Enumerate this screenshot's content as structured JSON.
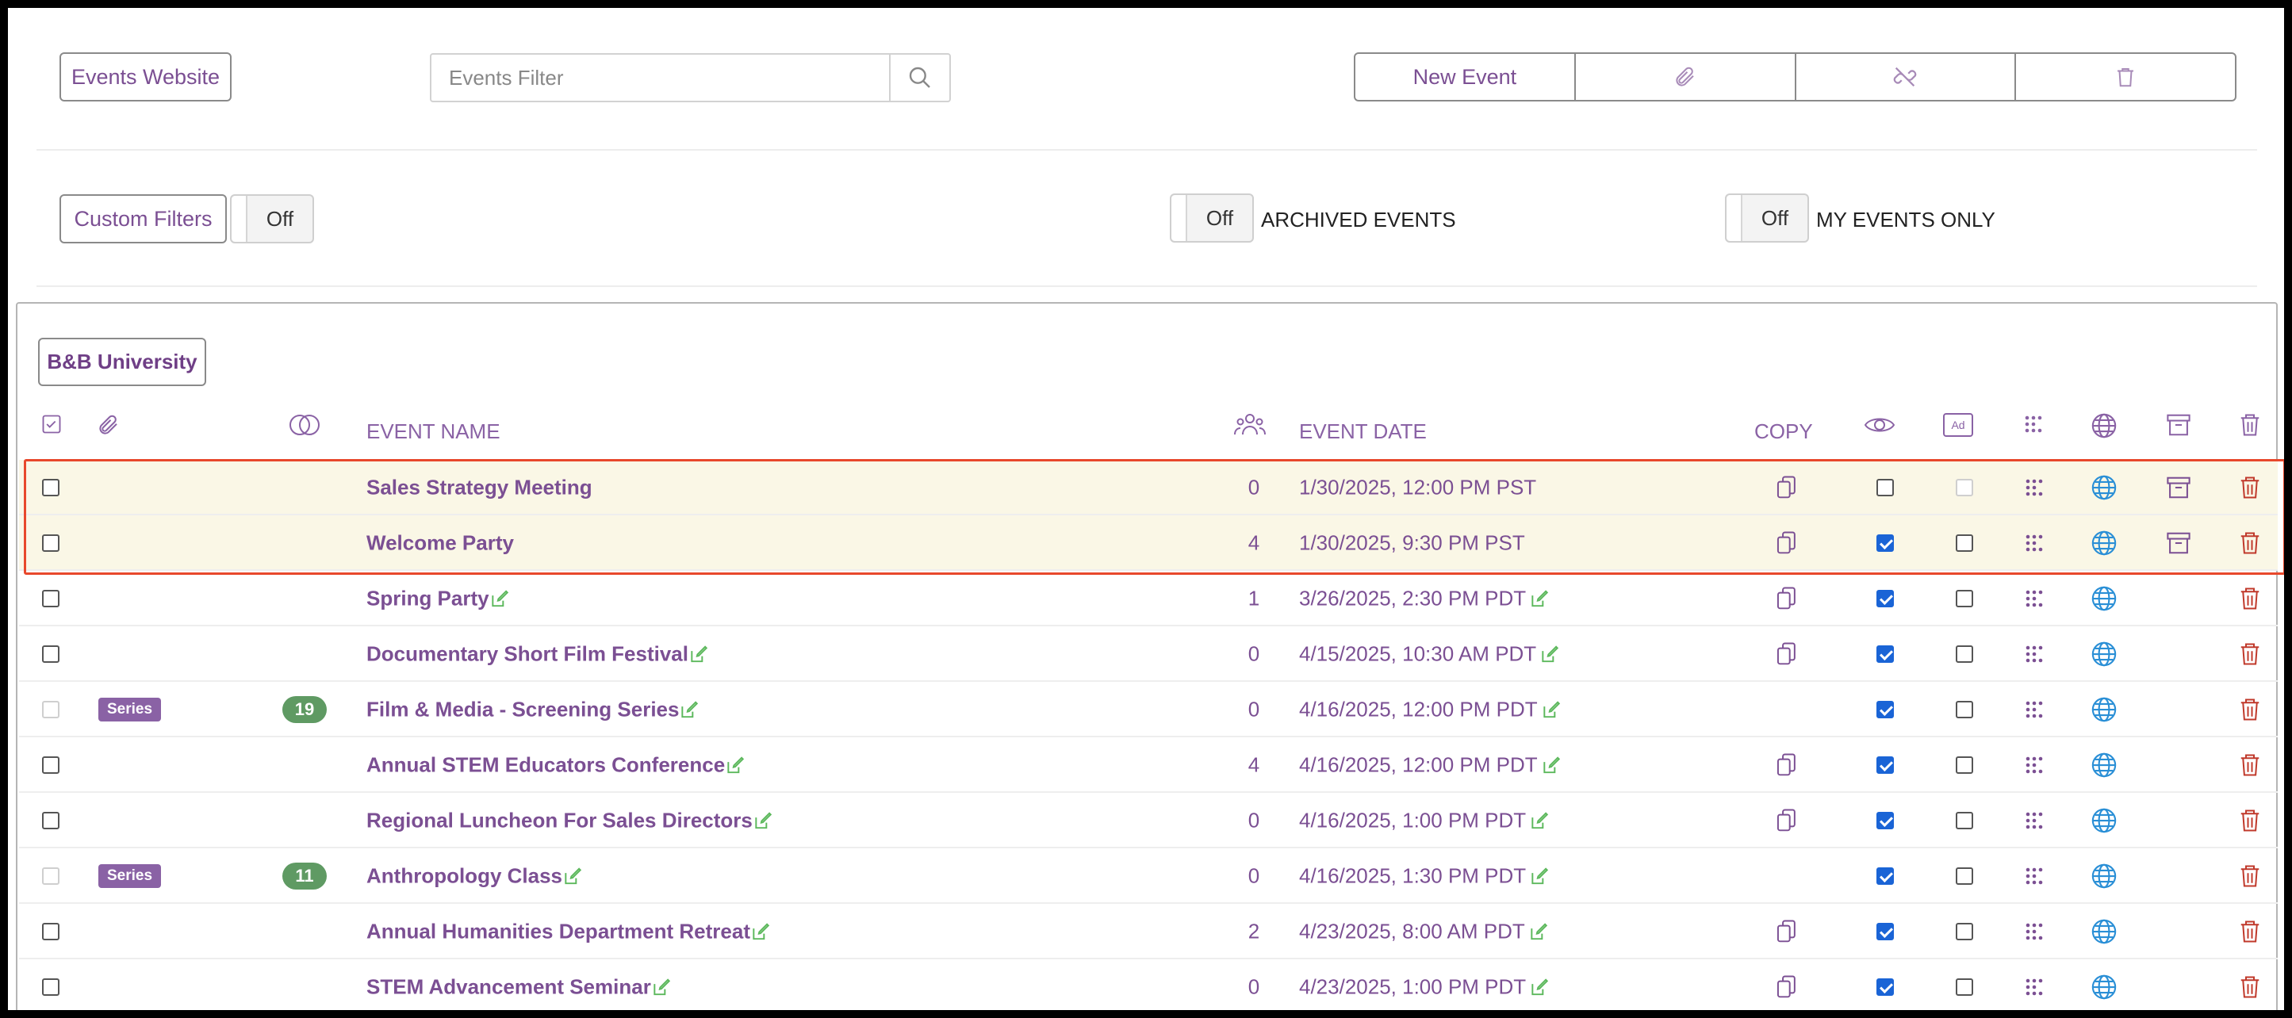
{
  "header": {
    "events_website_label": "Events Website",
    "filter_placeholder": "Events Filter",
    "new_event_label": "New Event",
    "icons": [
      "paperclip-icon",
      "unlink-icon",
      "trash-icon"
    ]
  },
  "filters": {
    "custom_filters_label": "Custom Filters",
    "custom_toggle": "Off",
    "archived_toggle": "Off",
    "archived_label": "ARCHIVED EVENTS",
    "my_events_toggle": "Off",
    "my_events_label": "MY EVENTS ONLY"
  },
  "org_button": "B&B University",
  "table": {
    "columns": {
      "event_name": "EVENT NAME",
      "event_date": "EVENT DATE",
      "copy": "COPY"
    },
    "rows": [
      {
        "name": "Sales Strategy Meeting",
        "attendees": "0",
        "date": "1/30/2025, 12:00 PM PST",
        "highlight": true,
        "editable": false,
        "copy": true,
        "visible": false,
        "ad": "disabled",
        "archive": true,
        "series": "",
        "count": "",
        "select_disabled": false
      },
      {
        "name": "Welcome Party",
        "attendees": "4",
        "date": "1/30/2025, 9:30 PM PST",
        "highlight": true,
        "editable": false,
        "copy": true,
        "visible": true,
        "ad": "off",
        "archive": true,
        "series": "",
        "count": "",
        "select_disabled": false
      },
      {
        "name": "Spring Party",
        "attendees": "1",
        "date": "3/26/2025, 2:30 PM PDT",
        "highlight": false,
        "editable": true,
        "copy": true,
        "visible": true,
        "ad": "off",
        "archive": false,
        "series": "",
        "count": "",
        "select_disabled": false
      },
      {
        "name": "Documentary Short Film Festival",
        "attendees": "0",
        "date": "4/15/2025, 10:30 AM PDT",
        "highlight": false,
        "editable": true,
        "copy": true,
        "visible": true,
        "ad": "off",
        "archive": false,
        "series": "",
        "count": "",
        "select_disabled": false
      },
      {
        "name": "Film & Media - Screening Series",
        "attendees": "0",
        "date": "4/16/2025, 12:00 PM PDT",
        "highlight": false,
        "editable": true,
        "copy": false,
        "visible": true,
        "ad": "off",
        "archive": false,
        "series": "Series",
        "count": "19",
        "select_disabled": true
      },
      {
        "name": "Annual STEM Educators Conference",
        "attendees": "4",
        "date": "4/16/2025, 12:00 PM PDT",
        "highlight": false,
        "editable": true,
        "copy": true,
        "visible": true,
        "ad": "off",
        "archive": false,
        "series": "",
        "count": "",
        "select_disabled": false
      },
      {
        "name": "Regional Luncheon For Sales Directors",
        "attendees": "0",
        "date": "4/16/2025, 1:00 PM PDT",
        "highlight": false,
        "editable": true,
        "copy": true,
        "visible": true,
        "ad": "off",
        "archive": false,
        "series": "",
        "count": "",
        "select_disabled": false
      },
      {
        "name": "Anthropology Class",
        "attendees": "0",
        "date": "4/16/2025, 1:30 PM PDT",
        "highlight": false,
        "editable": true,
        "copy": false,
        "visible": true,
        "ad": "off",
        "archive": false,
        "series": "Series",
        "count": "11",
        "select_disabled": true
      },
      {
        "name": "Annual Humanities Department Retreat",
        "attendees": "2",
        "date": "4/23/2025, 8:00 AM PDT",
        "highlight": false,
        "editable": true,
        "copy": true,
        "visible": true,
        "ad": "off",
        "archive": false,
        "series": "",
        "count": "",
        "select_disabled": false
      },
      {
        "name": "STEM Advancement Seminar",
        "attendees": "0",
        "date": "4/23/2025, 1:00 PM PDT",
        "highlight": false,
        "editable": true,
        "copy": true,
        "visible": true,
        "ad": "off",
        "archive": false,
        "series": "",
        "count": "",
        "select_disabled": false
      }
    ]
  },
  "colors": {
    "accent": "#7b4f93",
    "highlight_row": "#faf7e6",
    "highlight_border": "#e8482c",
    "delete": "#c0392b",
    "globe": "#2a8fd6",
    "edit": "#5cb85c",
    "series_badge": "#8a62a5",
    "count_badge": "#5f9a63"
  }
}
